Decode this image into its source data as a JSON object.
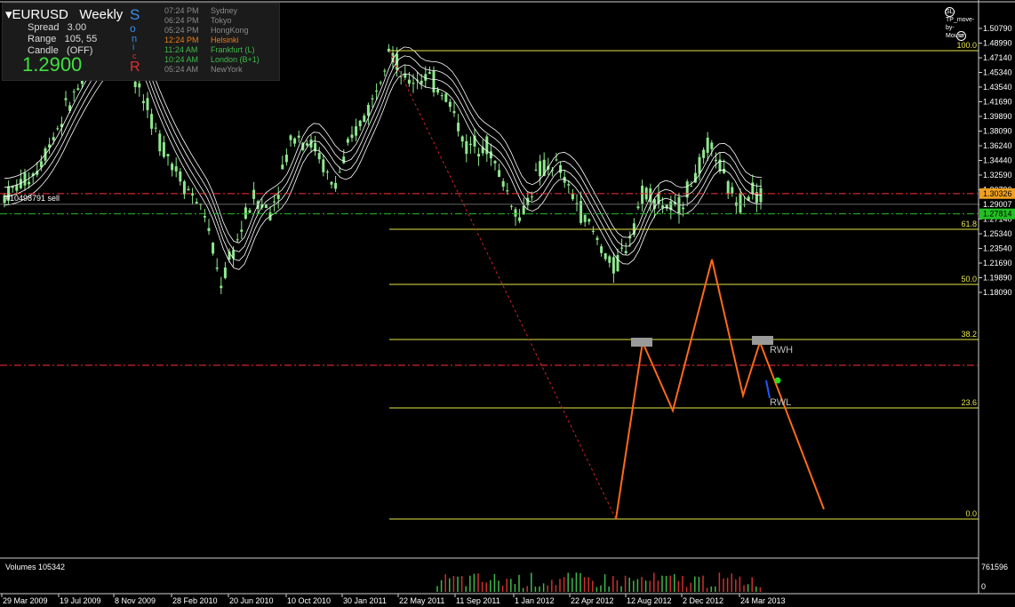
{
  "header": {
    "symbol": "EURUSD",
    "timeframe": "Weekly",
    "spread_label": "Spread",
    "spread_value": "3.00",
    "range_label": "Range",
    "range_value": "105, 55",
    "candle_label": "Candle",
    "candle_value": "(OFF)",
    "price": "1.2900",
    "sonic_letters": [
      "S",
      "o",
      "n",
      "i",
      "c",
      "R"
    ],
    "sessions": [
      {
        "time": "07:24 PM",
        "city": "Sydney",
        "color": "#8a8a8a"
      },
      {
        "time": "06:24 PM",
        "city": "Tokyo",
        "color": "#8a8a8a"
      },
      {
        "time": "05:24 PM",
        "city": "HongKong",
        "color": "#8a8a8a"
      },
      {
        "time": "12:24 PM",
        "city": "Helsinki",
        "color": "#e87c1e"
      },
      {
        "time": "11:24 AM",
        "city": "Frankfurt  (L)",
        "color": "#3fb84a"
      },
      {
        "time": "10:24 AM",
        "city": "London  (B+1)",
        "color": "#3fb84a"
      },
      {
        "time": "05:24 AM",
        "city": "NewYork",
        "color": "#8a8a8a"
      }
    ]
  },
  "top_right_label": "SL-TP_move-by-Mouse",
  "price_axis": [
    "1.50790",
    "1.48990",
    "1.47140",
    "1.45340",
    "1.43540",
    "1.41690",
    "1.39890",
    "1.38090",
    "1.36240",
    "1.34440",
    "1.32590",
    "1.30790",
    "1.28940",
    "1.27140",
    "1.25340",
    "1.23540",
    "1.21690",
    "1.19890",
    "1.18090"
  ],
  "price_markers": [
    {
      "label": "1.30326",
      "bg": "#f0a020",
      "fg": "#000"
    },
    {
      "label": "1.29007",
      "bg": "#000000",
      "fg": "#fff"
    },
    {
      "label": "1.27814",
      "bg": "#22c022",
      "fg": "#000"
    }
  ],
  "fib_levels": [
    "100.0",
    "61.8",
    "50.0",
    "38.2",
    "23.6",
    "0.0"
  ],
  "order_label": "#10498791 sell",
  "pattern_labels": [
    "RWH",
    "RWL"
  ],
  "volume": {
    "label": "Volumes 105342",
    "axis": [
      "761596",
      "0"
    ]
  },
  "time_axis": [
    "29 Mar 2009",
    "19 Jul 2009",
    "8 Nov 2009",
    "28 Feb 2010",
    "20 Jun 2010",
    "10 Oct 2010",
    "30 Jan 2011",
    "22 May 2011",
    "11 Sep 2011",
    "1 Jan 2012",
    "22 Apr 2012",
    "12 Aug 2012",
    "2 Dec 2012",
    "24 Mar 2013"
  ],
  "colors": {
    "background": "#000000",
    "candles": "#8ee88e",
    "fib": "#e6e64a",
    "envelope": "#ffffff",
    "zigzag": "#ff6a1a",
    "sell_line": "#ff3030",
    "tp_line": "#22c022"
  }
}
